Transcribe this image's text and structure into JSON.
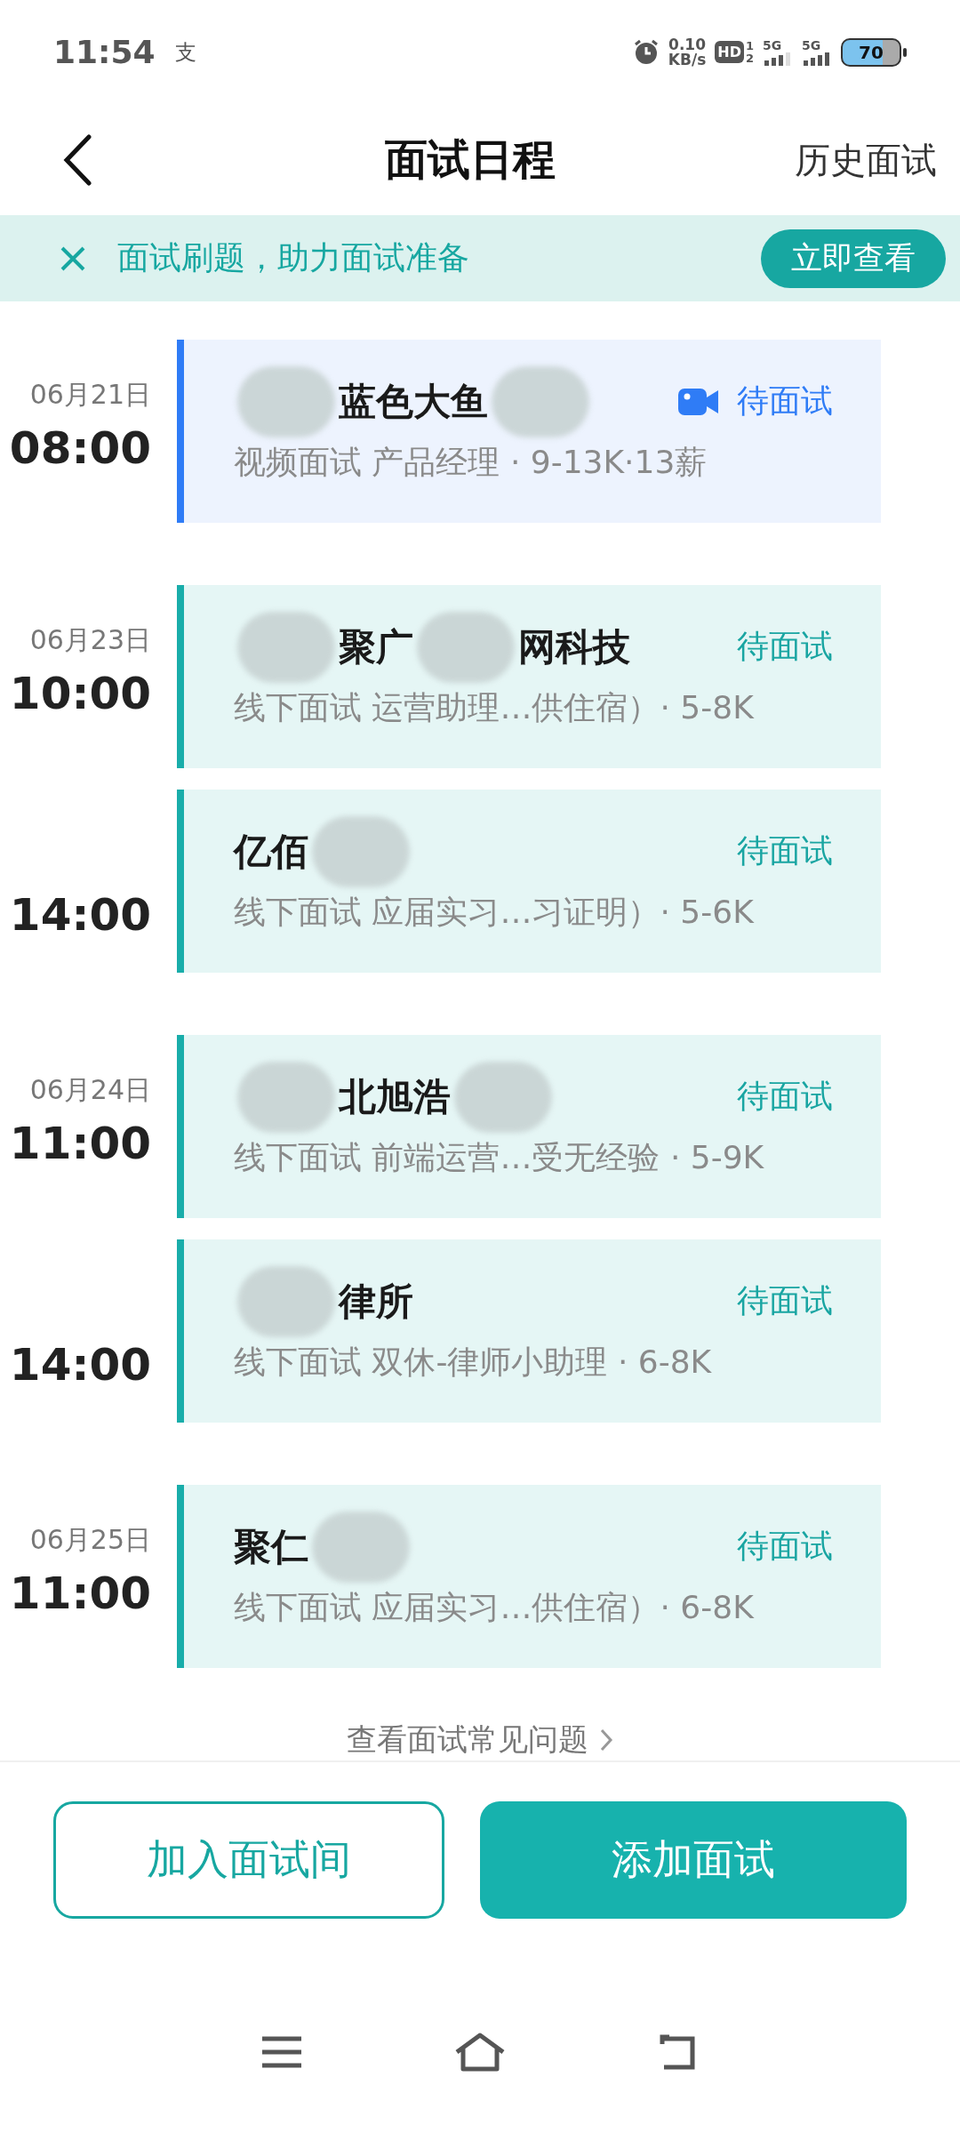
{
  "status_bar": {
    "time": "11:54",
    "notification": "支",
    "speed_value": "0.10",
    "speed_unit": "KB/s",
    "hd": "HD",
    "sim_slots": [
      "1",
      "2"
    ],
    "networks": [
      "5G",
      "5G"
    ],
    "battery": "70"
  },
  "header": {
    "title": "面试日程",
    "action": "历史面试"
  },
  "banner": {
    "text": "面试刷题，助力面试准备",
    "button": "立即查看"
  },
  "groups": [
    {
      "date": "06月21日",
      "items": [
        {
          "time": "08:00",
          "kind": "video",
          "title_parts": [
            {
              "kind": "blur"
            },
            {
              "kind": "text",
              "text": "蓝色大鱼"
            },
            {
              "kind": "blur"
            }
          ],
          "details": "视频面试 产品经理 · 9-13K·13薪",
          "status": "待面试"
        }
      ]
    },
    {
      "date": "06月23日",
      "items": [
        {
          "time": "10:00",
          "kind": "offline",
          "title_parts": [
            {
              "kind": "blur"
            },
            {
              "kind": "text",
              "text": "聚广"
            },
            {
              "kind": "blur"
            },
            {
              "kind": "text",
              "text": "网科技"
            }
          ],
          "details": "线下面试 运营助理…供住宿）· 5-8K",
          "status": "待面试"
        },
        {
          "time": "14:00",
          "kind": "offline",
          "title_parts": [
            {
              "kind": "text",
              "text": "亿佰"
            },
            {
              "kind": "blur"
            }
          ],
          "details": "线下面试 应届实习…习证明）· 5-6K",
          "status": "待面试"
        }
      ]
    },
    {
      "date": "06月24日",
      "items": [
        {
          "time": "11:00",
          "kind": "offline",
          "title_parts": [
            {
              "kind": "blur"
            },
            {
              "kind": "text",
              "text": "北旭浩"
            },
            {
              "kind": "blur"
            }
          ],
          "details": "线下面试 前端运营…受无经验 · 5-9K",
          "status": "待面试"
        },
        {
          "time": "14:00",
          "kind": "offline",
          "title_parts": [
            {
              "kind": "blur"
            },
            {
              "kind": "text",
              "text": "律所"
            }
          ],
          "details": "线下面试 双休-律师小助理 · 6-8K",
          "status": "待面试"
        }
      ]
    },
    {
      "date": "06月25日",
      "items": [
        {
          "time": "11:00",
          "kind": "offline",
          "title_parts": [
            {
              "kind": "text",
              "text": "聚仁"
            },
            {
              "kind": "blur"
            }
          ],
          "details": "线下面试 应届实习…供住宿）· 6-8K",
          "status": "待面试"
        }
      ]
    }
  ],
  "faq_link": "查看面试常见问题",
  "buttons": {
    "secondary": "加入面试间",
    "primary": "添加面试"
  }
}
